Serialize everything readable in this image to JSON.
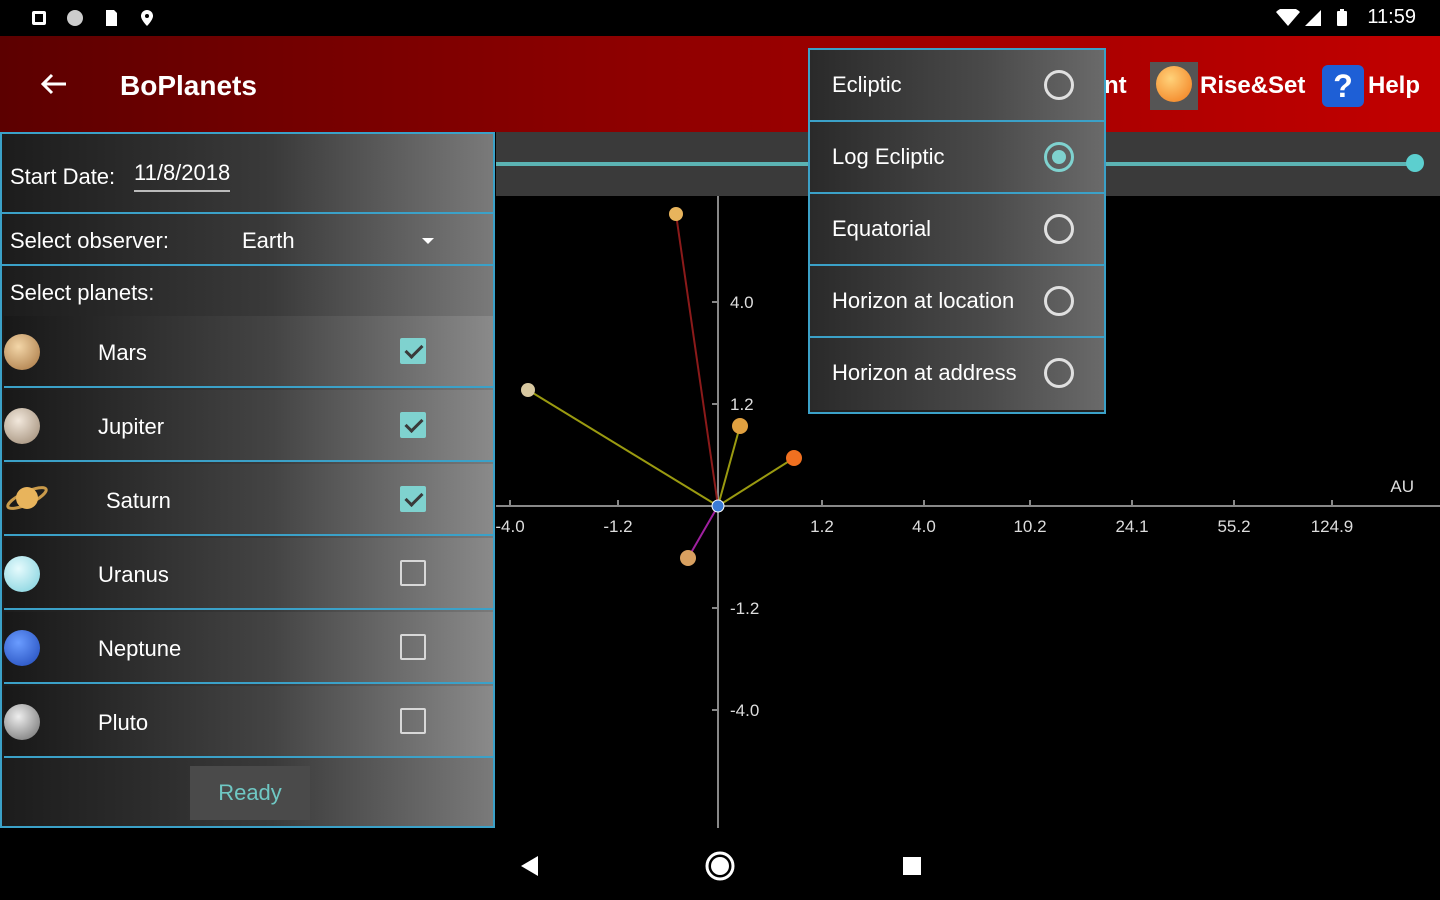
{
  "status_bar": {
    "time": "11:59"
  },
  "app_bar": {
    "title": "BoPlanets",
    "actions": [
      {
        "label": "nt",
        "partial": true
      },
      {
        "label": "Rise&Set",
        "icon": "sun-icon"
      },
      {
        "label": "Help",
        "icon": "help-icon"
      }
    ]
  },
  "panel": {
    "start_date_label": "Start Date:",
    "start_date_value": "11/8/2018",
    "observer_label": "Select observer:",
    "observer_value": "Earth",
    "planets_label": "Select planets:",
    "planets": [
      {
        "name": "Mars",
        "checked": true
      },
      {
        "name": "Jupiter",
        "checked": true
      },
      {
        "name": "Saturn",
        "checked": true
      },
      {
        "name": "Uranus",
        "checked": false
      },
      {
        "name": "Neptune",
        "checked": false
      },
      {
        "name": "Pluto",
        "checked": false
      }
    ],
    "ready_label": "Ready"
  },
  "view_menu": {
    "items": [
      {
        "label": "Ecliptic",
        "selected": false
      },
      {
        "label": "Log Ecliptic",
        "selected": true
      },
      {
        "label": "Equatorial",
        "selected": false
      },
      {
        "label": "Horizon at location",
        "selected": false
      },
      {
        "label": "Horizon at address",
        "selected": false
      }
    ]
  },
  "chart_data": {
    "type": "scatter",
    "x_unit": "AU",
    "x_ticks": [
      "-4.0",
      "-1.2",
      "1.2",
      "4.0",
      "10.2",
      "24.1",
      "55.2",
      "124.9"
    ],
    "y_ticks": [
      "4.0",
      "1.2",
      "-1.2",
      "-4.0"
    ],
    "origin_label": "Earth"
  },
  "colors": {
    "accent": "#3ba1c8",
    "check": "#7fd2cf",
    "appbar_dark": "#5c0000",
    "appbar_light": "#c20000"
  }
}
